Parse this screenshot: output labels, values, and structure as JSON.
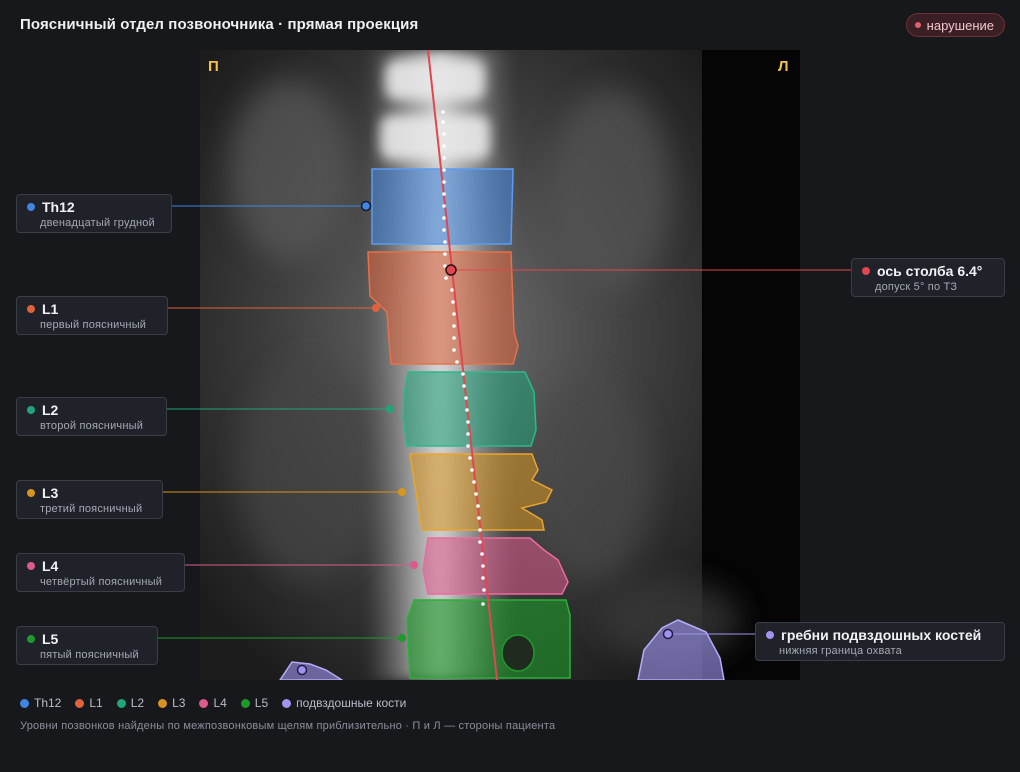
{
  "header": {
    "title": "Поясничный отдел позвоночника · прямая проекция",
    "status_badge": "нарушение"
  },
  "image": {
    "side_left": "П",
    "side_right": "Л"
  },
  "vertebrae": [
    {
      "id": "th12",
      "label": "Th12",
      "description": "двенадцатый грудной",
      "color": "#3f86e0"
    },
    {
      "id": "l1",
      "label": "L1",
      "description": "первый поясничный",
      "color": "#e0623a"
    },
    {
      "id": "l2",
      "label": "L2",
      "description": "второй поясничный",
      "color": "#21a37c"
    },
    {
      "id": "l3",
      "label": "L3",
      "description": "третий поясничный",
      "color": "#d8941e"
    },
    {
      "id": "l4",
      "label": "L4",
      "description": "четвёртый поясничный",
      "color": "#dd5a8d"
    },
    {
      "id": "l5",
      "label": "L5",
      "description": "пятый поясничный",
      "color": "#1e9a2a"
    }
  ],
  "axis_callout": {
    "label": "ось столба 6.4°",
    "description": "допуск 5° по ТЗ",
    "color": "#e0474f",
    "angle_deg": 6.4,
    "tolerance_deg": 5
  },
  "iliac_callout": {
    "label": "гребни подвздошных костей",
    "description": "нижняя граница охвата",
    "color": "#9d94f0"
  },
  "legend": [
    {
      "label": "Th12",
      "color": "#3f86e0"
    },
    {
      "label": "L1",
      "color": "#e0623a"
    },
    {
      "label": "L2",
      "color": "#21a37c"
    },
    {
      "label": "L3",
      "color": "#d8941e"
    },
    {
      "label": "L4",
      "color": "#dd5a8d"
    },
    {
      "label": "L5",
      "color": "#1e9a2a"
    },
    {
      "label": "подвздошные кости",
      "color": "#9d94f0"
    }
  ],
  "footnote": "Уровни позвонков найдены по межпозвонковым щелям приблизительно · П и Л — стороны пациента"
}
